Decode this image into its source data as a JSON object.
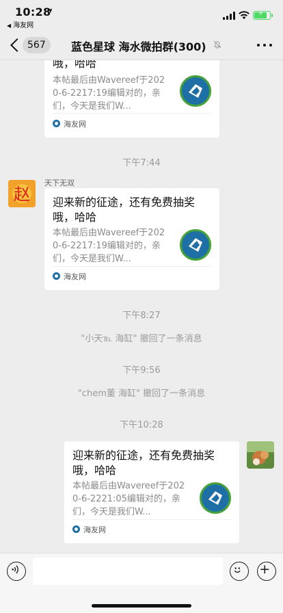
{
  "status_bar": {
    "time": "10:28",
    "location_arrow": "➤",
    "back_app_label": "海友网",
    "back_arrow": "◀"
  },
  "nav": {
    "unread_count": "567",
    "title": "蓝色星球 海水微拍群(300)"
  },
  "messages": [
    {
      "type": "card",
      "side": "left",
      "title_fragment": "哦，哈哈",
      "desc": "本帖最后由Wavereef于2020-6-2217:19编辑对的，亲们，今天是我们W...",
      "source": "海友网"
    },
    {
      "type": "timestamp",
      "text": "下午7:44"
    },
    {
      "type": "card",
      "side": "left",
      "sender": "天下无双",
      "avatar_char": "赵",
      "title": "迎来新的征途，还有免费抽奖哦，哈哈",
      "desc": "本帖最后由Wavereef于2020-6-2217:19编辑对的，亲们，今天是我们W...",
      "source": "海友网"
    },
    {
      "type": "timestamp",
      "text": "下午8:27"
    },
    {
      "type": "system",
      "text": "\"小天℡ 海缸\" 撤回了一条消息"
    },
    {
      "type": "timestamp",
      "text": "下午9:56"
    },
    {
      "type": "system",
      "text": "\"chem董 海缸\" 撤回了一条消息"
    },
    {
      "type": "timestamp",
      "text": "下午10:28"
    },
    {
      "type": "card",
      "side": "right",
      "title": "迎来新的征途，还有免费抽奖哦，哈哈",
      "desc": "本帖最后由Wavereef于2020-6-2221:05编辑对的，亲们，今天是我们W...",
      "source": "海友网"
    }
  ],
  "icons": {
    "back": "chevron-left-icon",
    "mute": "bell-slash-icon",
    "more": "more-dots-icon",
    "voice": "voice-icon",
    "emoji": "emoji-icon",
    "plus": "plus-icon"
  },
  "colors": {
    "background": "#ededed",
    "bubble": "#ffffff",
    "battery": "#4cd964",
    "muted_text": "#9a9a9a"
  }
}
